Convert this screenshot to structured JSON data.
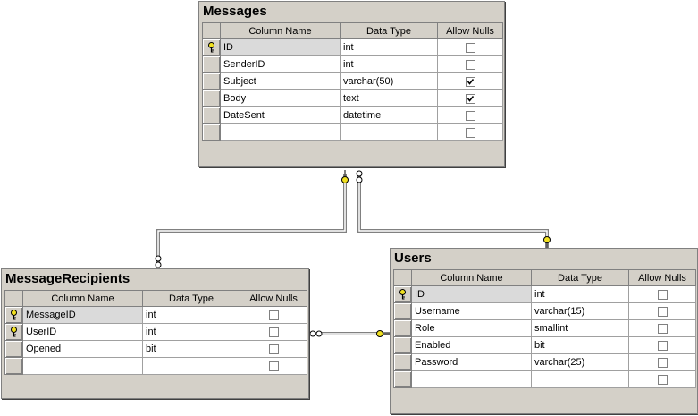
{
  "columns": {
    "name": "Column Name",
    "type": "Data Type",
    "nulls": "Allow Nulls"
  },
  "messages": {
    "title": "Messages",
    "rows": [
      {
        "name": "ID",
        "type": "int",
        "nulls": false,
        "key": true
      },
      {
        "name": "SenderID",
        "type": "int",
        "nulls": false,
        "key": false
      },
      {
        "name": "Subject",
        "type": "varchar(50)",
        "nulls": true,
        "key": false
      },
      {
        "name": "Body",
        "type": "text",
        "nulls": true,
        "key": false
      },
      {
        "name": "DateSent",
        "type": "datetime",
        "nulls": false,
        "key": false
      },
      {
        "name": "",
        "type": "",
        "nulls": false,
        "key": false
      }
    ]
  },
  "recipients": {
    "title": "MessageRecipients",
    "rows": [
      {
        "name": "MessageID",
        "type": "int",
        "nulls": false,
        "key": true
      },
      {
        "name": "UserID",
        "type": "int",
        "nulls": false,
        "key": true
      },
      {
        "name": "Opened",
        "type": "bit",
        "nulls": false,
        "key": false
      },
      {
        "name": "",
        "type": "",
        "nulls": false,
        "key": false
      }
    ]
  },
  "users": {
    "title": "Users",
    "rows": [
      {
        "name": "ID",
        "type": "int",
        "nulls": false,
        "key": true
      },
      {
        "name": "Username",
        "type": "varchar(15)",
        "nulls": false,
        "key": false
      },
      {
        "name": "Role",
        "type": "smallint",
        "nulls": false,
        "key": false
      },
      {
        "name": "Enabled",
        "type": "bit",
        "nulls": false,
        "key": false
      },
      {
        "name": "Password",
        "type": "varchar(25)",
        "nulls": false,
        "key": false
      },
      {
        "name": "",
        "type": "",
        "nulls": false,
        "key": false
      }
    ]
  },
  "colors": {
    "key_icon": "#f0e020",
    "window_bg": "#d4d0c8",
    "link": "#808080"
  }
}
